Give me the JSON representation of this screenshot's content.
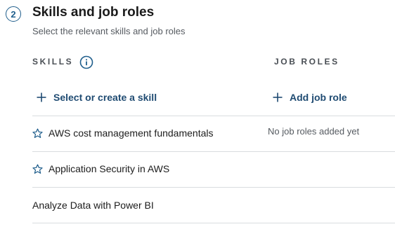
{
  "section": {
    "step_number": "2",
    "title": "Skills and job roles",
    "subtitle": "Select the relevant skills and job roles"
  },
  "skills": {
    "header": "SKILLS",
    "add_label": "Select or create a skill",
    "items": [
      {
        "label": "AWS cost management fundamentals",
        "icon": "star-outline-icon"
      },
      {
        "label": "Application Security in AWS",
        "icon": "star-outline-icon"
      },
      {
        "label": "Analyze Data with Power BI",
        "icon": ""
      }
    ]
  },
  "job_roles": {
    "header": "JOB ROLES",
    "add_label": "Add job role",
    "empty_text": "No job roles added yet"
  },
  "colors": {
    "accent": "#1f5e8c",
    "link": "#1f4b72",
    "divider": "#d9dcdf"
  }
}
